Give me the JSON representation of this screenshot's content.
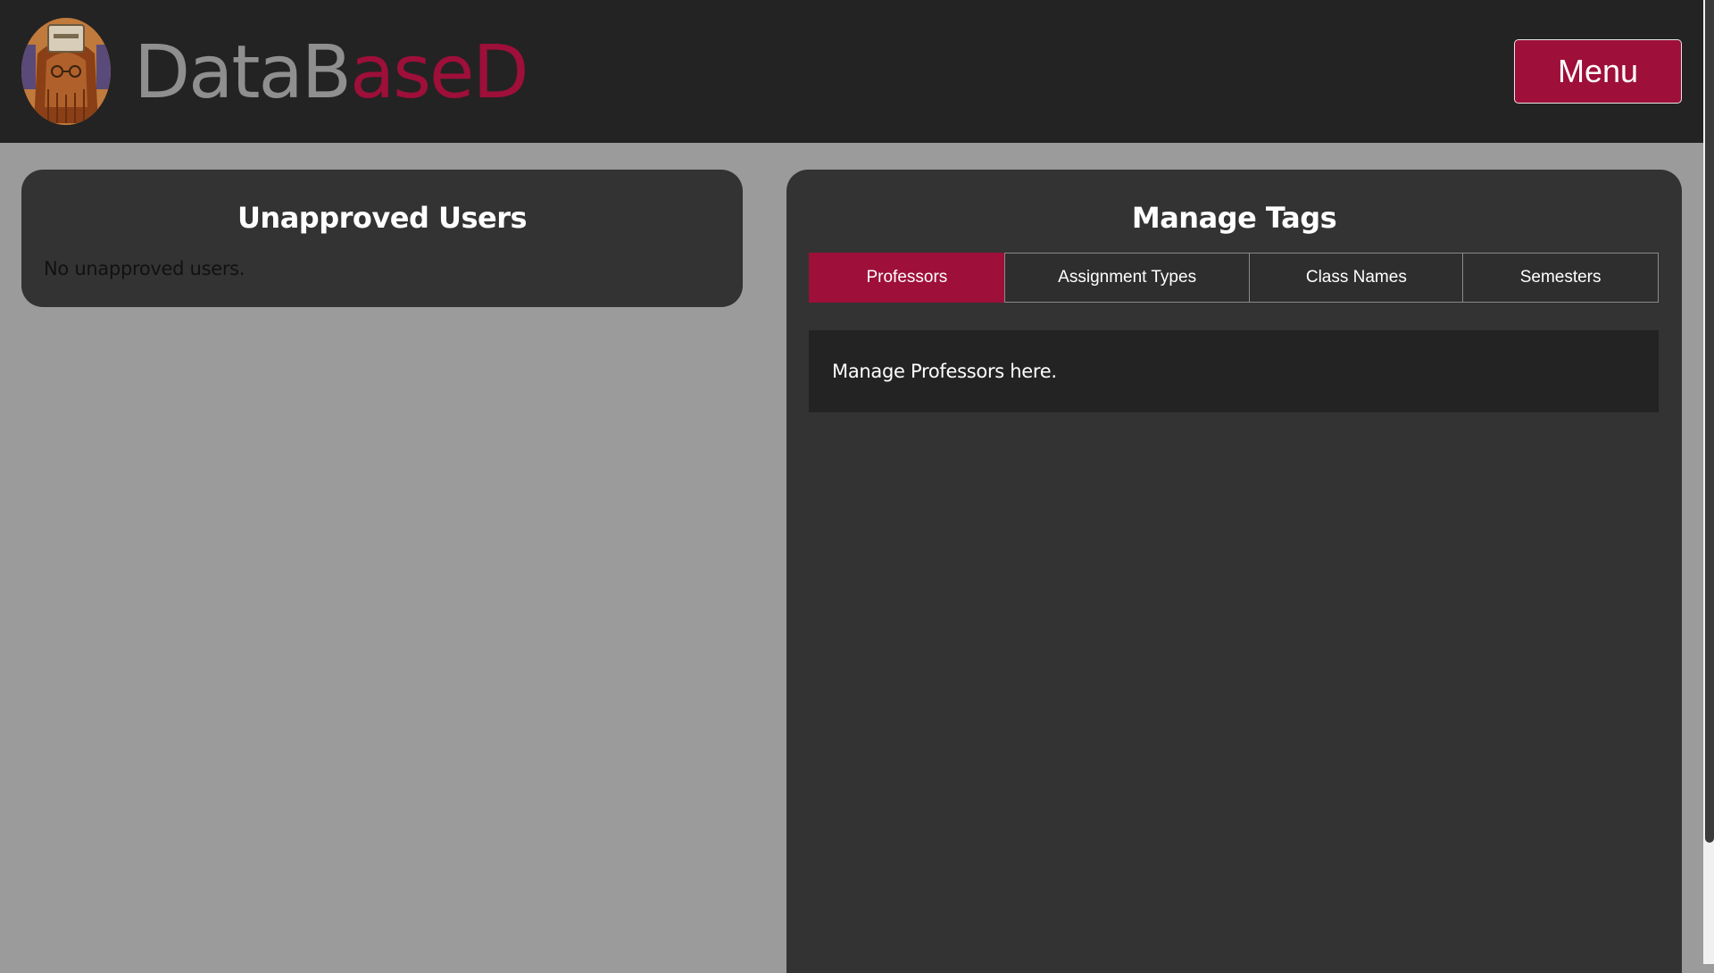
{
  "header": {
    "logo_icon": "avatar-logo",
    "brand_part1": "DataB",
    "brand_part2": "aseD",
    "menu_label": "Menu",
    "brand_gray": "#8f8f8f",
    "brand_accent": "#9e0f3a"
  },
  "unapproved_users": {
    "title": "Unapproved Users",
    "empty_message": "No unapproved users."
  },
  "manage_tags": {
    "title": "Manage Tags",
    "tabs": [
      {
        "label": "Professors",
        "active": true
      },
      {
        "label": "Assignment Types",
        "active": false
      },
      {
        "label": "Class Names",
        "active": false
      },
      {
        "label": "Semesters",
        "active": false
      }
    ],
    "content_text": "Manage Professors here."
  },
  "colors": {
    "accent": "#9e0f3a",
    "header_bg": "#232323",
    "panel_bg": "#333333",
    "page_bg": "#9b9b9b"
  }
}
